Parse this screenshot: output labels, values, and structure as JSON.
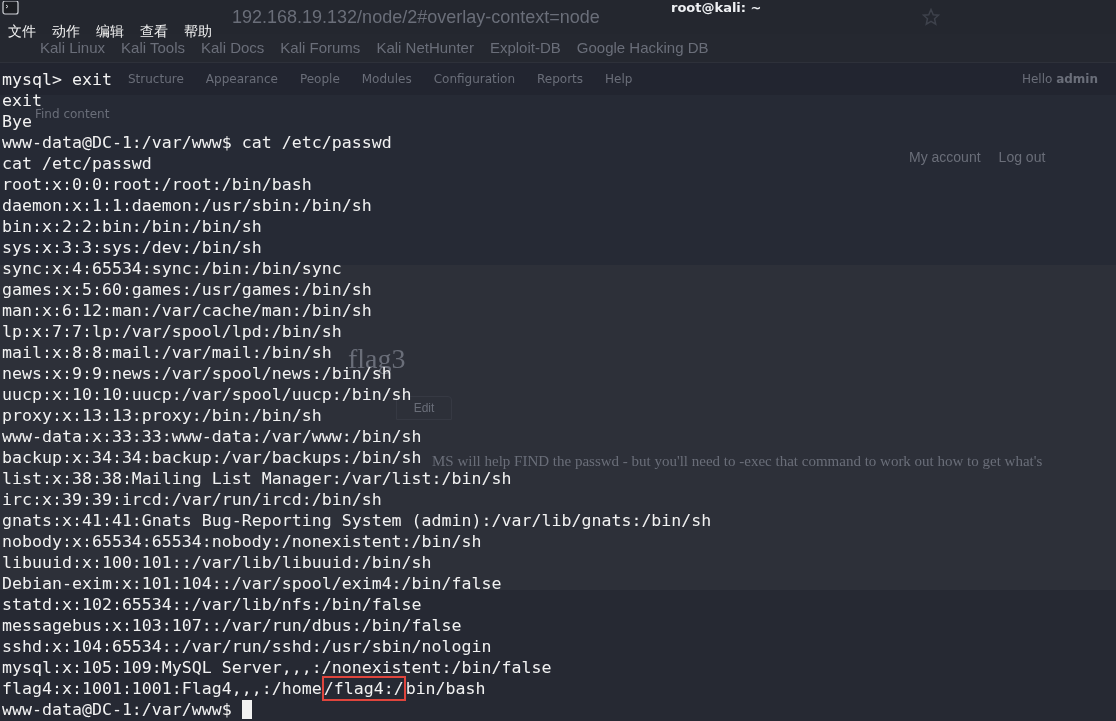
{
  "window": {
    "title": "root@kali: ~"
  },
  "menu": [
    "文件",
    "动作",
    "编辑",
    "查看",
    "帮助"
  ],
  "background_browser": {
    "url": "192.168.19.132/node/2#overlay-context=node",
    "bookmarks": [
      "Kali Linux",
      "Kali Tools",
      "Kali Docs",
      "Kali Forums",
      "Kali NetHunter",
      "Exploit-DB",
      "Google Hacking DB"
    ],
    "admin_menu": [
      "Structure",
      "Appearance",
      "People",
      "Modules",
      "Configuration",
      "Reports",
      "Help"
    ],
    "greeting": "Hello **admin**",
    "shortcut": "Find content",
    "account_links": [
      "My account",
      "Log out"
    ],
    "page_title": "flag3",
    "tab": "Edit",
    "body_text": "MS will help FIND the passwd - but you'll need to -exec that command to work out how to get what's"
  },
  "terminal": {
    "lines": [
      {
        "kind": "output",
        "text": "mysql> exit"
      },
      {
        "kind": "output",
        "text": "exit"
      },
      {
        "kind": "output",
        "text": "Bye"
      },
      {
        "kind": "output",
        "text": "www-data@DC-1:/var/www$ cat /etc/passwd"
      },
      {
        "kind": "output",
        "text": "cat /etc/passwd"
      },
      {
        "kind": "output",
        "text": "root:x:0:0:root:/root:/bin/bash"
      },
      {
        "kind": "output",
        "text": "daemon:x:1:1:daemon:/usr/sbin:/bin/sh"
      },
      {
        "kind": "output",
        "text": "bin:x:2:2:bin:/bin:/bin/sh"
      },
      {
        "kind": "output",
        "text": "sys:x:3:3:sys:/dev:/bin/sh"
      },
      {
        "kind": "output",
        "text": "sync:x:4:65534:sync:/bin:/bin/sync"
      },
      {
        "kind": "output",
        "text": "games:x:5:60:games:/usr/games:/bin/sh"
      },
      {
        "kind": "output",
        "text": "man:x:6:12:man:/var/cache/man:/bin/sh"
      },
      {
        "kind": "output",
        "text": "lp:x:7:7:lp:/var/spool/lpd:/bin/sh"
      },
      {
        "kind": "output",
        "text": "mail:x:8:8:mail:/var/mail:/bin/sh"
      },
      {
        "kind": "output",
        "text": "news:x:9:9:news:/var/spool/news:/bin/sh"
      },
      {
        "kind": "output",
        "text": "uucp:x:10:10:uucp:/var/spool/uucp:/bin/sh"
      },
      {
        "kind": "output",
        "text": "proxy:x:13:13:proxy:/bin:/bin/sh"
      },
      {
        "kind": "output",
        "text": "www-data:x:33:33:www-data:/var/www:/bin/sh"
      },
      {
        "kind": "output",
        "text": "backup:x:34:34:backup:/var/backups:/bin/sh"
      },
      {
        "kind": "output",
        "text": "list:x:38:38:Mailing List Manager:/var/list:/bin/sh"
      },
      {
        "kind": "output",
        "text": "irc:x:39:39:ircd:/var/run/ircd:/bin/sh"
      },
      {
        "kind": "output",
        "text": "gnats:x:41:41:Gnats Bug-Reporting System (admin):/var/lib/gnats:/bin/sh"
      },
      {
        "kind": "output",
        "text": "nobody:x:65534:65534:nobody:/nonexistent:/bin/sh"
      },
      {
        "kind": "output",
        "text": "libuuid:x:100:101::/var/lib/libuuid:/bin/sh"
      },
      {
        "kind": "output",
        "text": "Debian-exim:x:101:104::/var/spool/exim4:/bin/false"
      },
      {
        "kind": "output",
        "text": "statd:x:102:65534::/var/lib/nfs:/bin/false"
      },
      {
        "kind": "output",
        "text": "messagebus:x:103:107::/var/run/dbus:/bin/false"
      },
      {
        "kind": "output",
        "text": "sshd:x:104:65534::/var/run/sshd:/usr/sbin/nologin"
      },
      {
        "kind": "output",
        "text": "mysql:x:105:109:MySQL Server,,,:/nonexistent:/bin/false"
      },
      {
        "kind": "highlight",
        "before": "flag4:x:1001:1001:Flag4,,,:/home",
        "marked": "/flag4:/",
        "after": "bin/bash"
      },
      {
        "kind": "prompt",
        "text": "www-data@DC-1:/var/www$",
        "cursor": true
      }
    ]
  }
}
